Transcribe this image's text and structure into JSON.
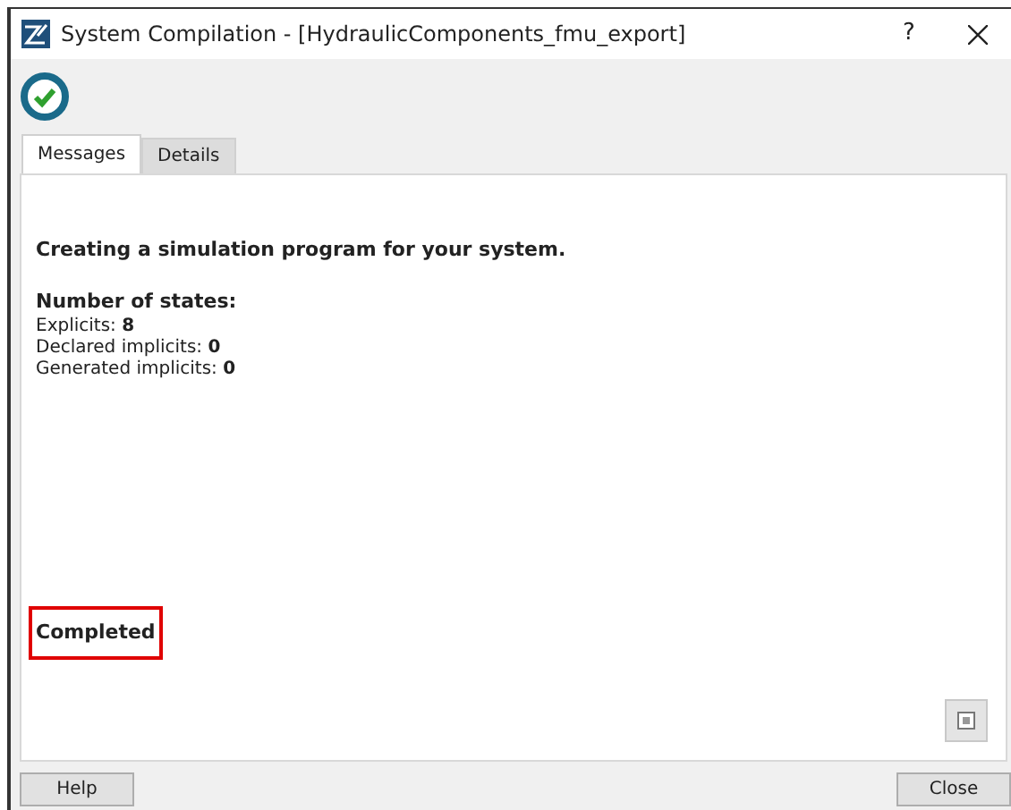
{
  "window": {
    "title": "System Compilation - [HydraulicComponents_fmu_export]",
    "help": "?"
  },
  "tabs": [
    {
      "label": "Messages",
      "selected": true
    },
    {
      "label": "Details",
      "selected": false
    }
  ],
  "messages": {
    "heading": "Creating a simulation program for your system.",
    "states_heading": "Number of states:",
    "lines": [
      {
        "label": "Explicits:",
        "value": "8"
      },
      {
        "label": "Declared implicits:",
        "value": "0"
      },
      {
        "label": "Generated implicits:",
        "value": "0"
      }
    ],
    "status": {
      "text": "Completed",
      "highlighted": true
    }
  },
  "buttons": [
    "Help",
    "Close"
  ]
}
